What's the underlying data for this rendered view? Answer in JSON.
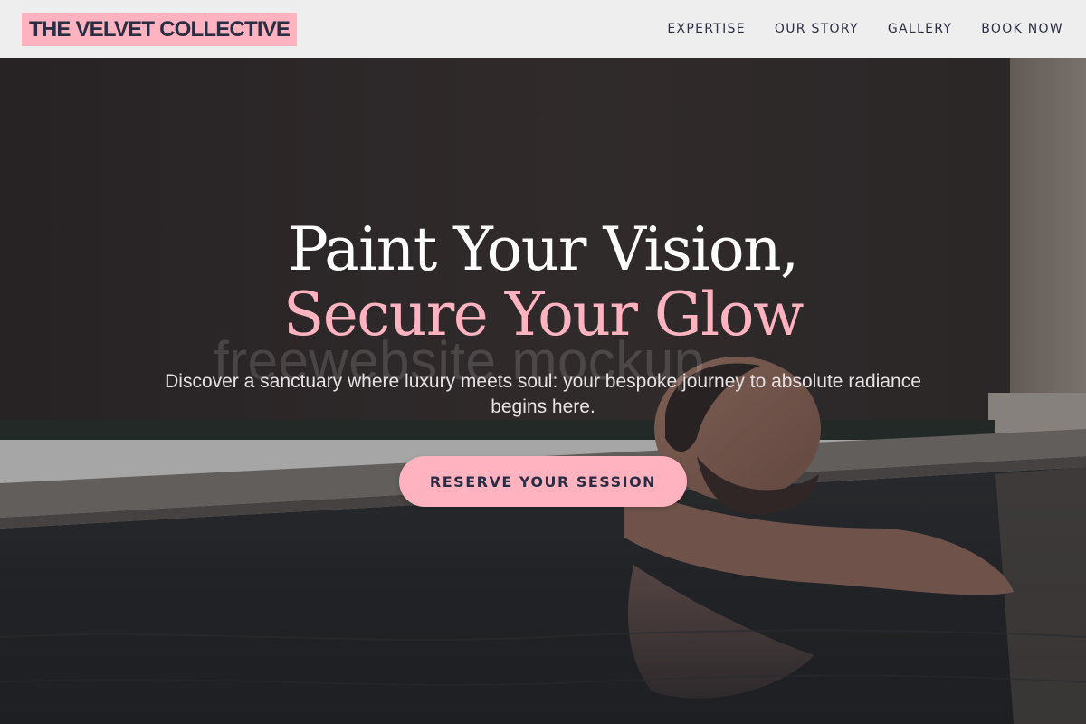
{
  "brand": {
    "name": "THE VELVET COLLECTIVE"
  },
  "nav": {
    "items": [
      {
        "label": "EXPERTISE"
      },
      {
        "label": "OUR STORY"
      },
      {
        "label": "GALLERY"
      },
      {
        "label": "BOOK NOW"
      }
    ]
  },
  "hero": {
    "headline_line1": "Paint Your Vision,",
    "headline_line2": "Secure Your Glow",
    "subtitle": "Discover a sanctuary where luxury meets soul: your bespoke journey to absolute radiance begins here.",
    "cta_label": "RESERVE YOUR SESSION",
    "watermark": "freewebsite mockup",
    "image_subject": "man-relaxing-in-pool"
  },
  "colors": {
    "accent_pink": "#ffb3c1",
    "text_dark": "#2b2d42",
    "nav_background": "#eeeeee",
    "headline_white": "#ffffff"
  }
}
